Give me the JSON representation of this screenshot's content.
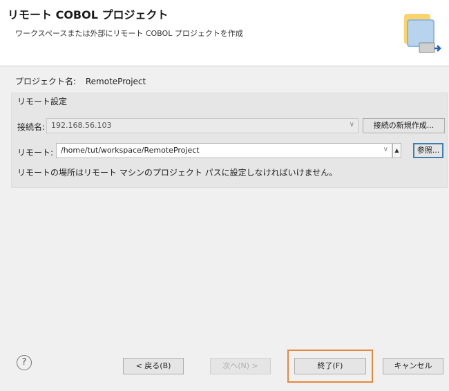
{
  "header": {
    "title": "リモート COBOL プロジェクト",
    "description": "ワークスペースまたは外部にリモート COBOL プロジェクトを作成"
  },
  "project": {
    "label": "プロジェクト名:",
    "value": "RemoteProject"
  },
  "remote_settings": {
    "group_label": "リモート設定",
    "connection_label": "接続名:",
    "connection_value": "192.168.56.103",
    "new_connection_button": "接続の新規作成...",
    "remote_label": "リモート:",
    "remote_value": "/home/tut/workspace/RemoteProject",
    "browse_button": "参照...",
    "note": "リモートの場所はリモート マシンのプロジェクト パスに設定しなければいけません。"
  },
  "footer": {
    "back_button": "< 戻る(B)",
    "next_button": "次へ(N) >",
    "finish_button": "終了(F)",
    "cancel_button": "キャンセル"
  },
  "colors": {
    "highlight": "#e8873b",
    "focus": "#3c7fb1"
  }
}
